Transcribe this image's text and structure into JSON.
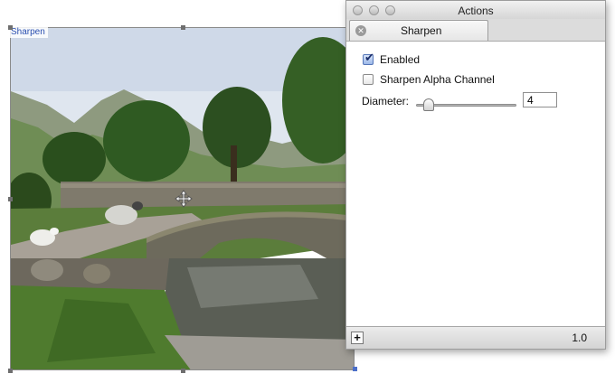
{
  "canvas": {
    "layer_label": "Sharpen"
  },
  "panel": {
    "window_title": "Actions",
    "tab_label": "Sharpen",
    "enabled_label": "Enabled",
    "enabled_checked": true,
    "alpha_label": "Sharpen Alpha Channel",
    "alpha_checked": false,
    "diameter_label": "Diameter:",
    "diameter_value": "4",
    "diameter_fraction": 0.08,
    "add_button": "+",
    "version": "1.0"
  },
  "icons": {
    "close": "tab-close-icon",
    "move": "move-cursor-icon",
    "add": "plus-icon"
  }
}
